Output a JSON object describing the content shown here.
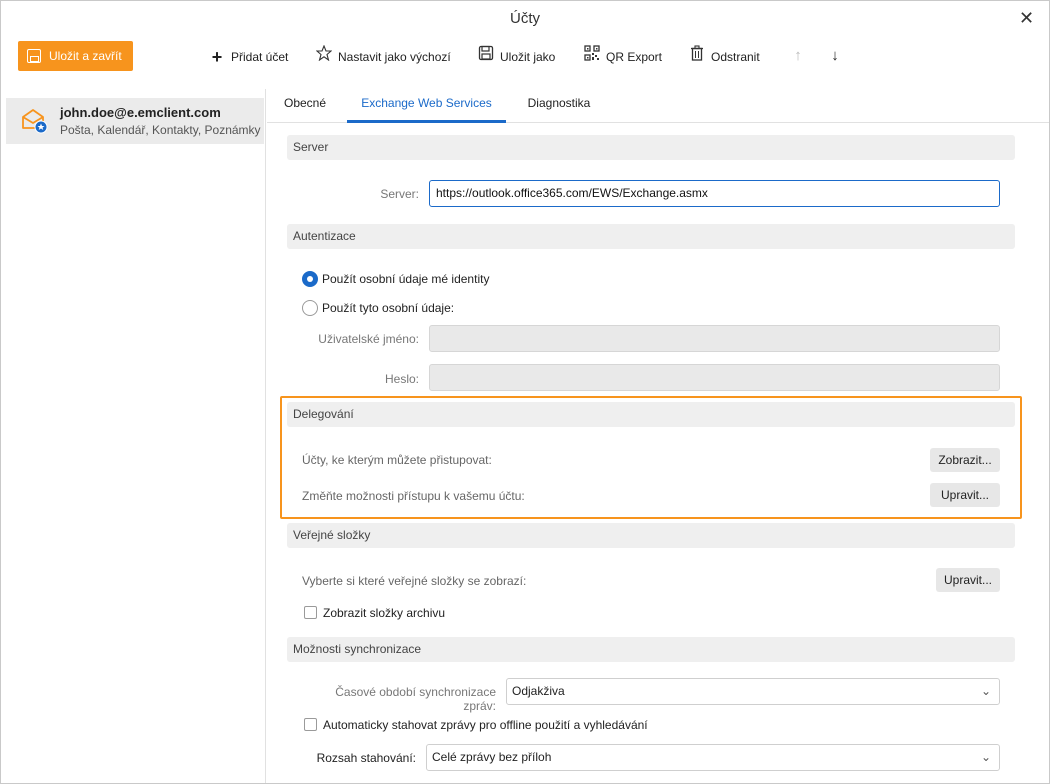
{
  "window": {
    "title": "Účty"
  },
  "toolbar": {
    "save_close": "Uložit a zavřít",
    "add_account": "Přidat účet",
    "set_default": "Nastavit jako výchozí",
    "save_as": "Uložit jako",
    "qr_export": "QR Export",
    "remove": "Odstranit",
    "move_up": "↑",
    "move_down": "↓"
  },
  "sidebar": {
    "accounts": [
      {
        "email": "john.doe@e.emclient.com",
        "services": "Pošta, Kalendář, Kontakty, Poznámky"
      }
    ]
  },
  "tabs": [
    {
      "label": "Obecné",
      "active": false
    },
    {
      "label": "Exchange Web Services",
      "active": true
    },
    {
      "label": "Diagnostika",
      "active": false
    }
  ],
  "server": {
    "header": "Server",
    "label": "Server:",
    "value": "https://outlook.office365.com/EWS/Exchange.asmx"
  },
  "auth": {
    "header": "Autentizace",
    "option_identity": "Použít osobní údaje mé identity",
    "option_custom": "Použít tyto osobní údaje:",
    "selected": "identity",
    "username_label": "Uživatelské jméno:",
    "password_label": "Heslo:"
  },
  "delegation": {
    "header": "Delegování",
    "accessible_label": "Účty, ke kterým můžete přistupovat:",
    "show_button": "Zobrazit...",
    "change_label": "Změňte možnosti přístupu k vašemu účtu:",
    "edit_button": "Upravit..."
  },
  "public_folders": {
    "header": "Veřejné složky",
    "choose_label": "Vyberte si které veřejné složky se zobrazí:",
    "edit_button": "Upravit...",
    "show_archive": "Zobrazit složky archivu",
    "show_archive_checked": false
  },
  "sync": {
    "header": "Možnosti synchronizace",
    "period_label": "Časové období synchronizace zpráv:",
    "period_value": "Odjakživa",
    "auto_download": "Automaticky stahovat zprávy pro offline použití a vyhledávání",
    "auto_download_checked": false,
    "range_label": "Rozsah stahování:",
    "range_value": "Celé zprávy bez příloh"
  },
  "colors": {
    "accent": "#1b6ac9",
    "brand_orange": "#f7941d"
  }
}
